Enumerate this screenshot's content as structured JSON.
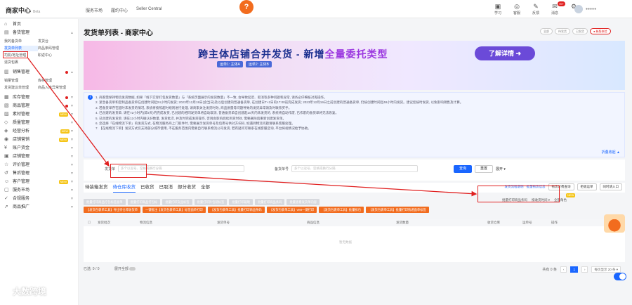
{
  "topbar": {
    "logo": "商家中心",
    "logo_beta": "Beta",
    "nav": [
      "服务市场",
      "履约中心",
      "Seller Central"
    ],
    "center_badge": "?",
    "icons": [
      {
        "name": "study-icon",
        "glyph": "▣",
        "label": "学习"
      },
      {
        "name": "support-icon",
        "glyph": "◎",
        "label": "客服"
      },
      {
        "name": "feedback-icon",
        "glyph": "✎",
        "label": "反馈"
      },
      {
        "name": "message-icon",
        "glyph": "✉",
        "label": "消息",
        "badge": "99+"
      },
      {
        "name": "settings-icon",
        "glyph": "⚙",
        "label": ""
      }
    ],
    "user_text": "●●●●●"
  },
  "sidebar": {
    "items": [
      {
        "label": "首页",
        "icon": "⌂"
      },
      {
        "label": "备货管理",
        "icon": "▤",
        "expanded": true,
        "sub": [
          "我的备货单",
          "发货台",
          "发货单列表",
          "商品条码管理",
          "司机/地址管理",
          "职返中心",
          "退货包裹"
        ]
      },
      {
        "label": "销售管理",
        "icon": "▥",
        "expanded": true,
        "dot": true,
        "sub": [
          "销量管理",
          "库存管理",
          "发货建议单管理",
          "商品入库异常管理"
        ]
      },
      {
        "label": "库存管理",
        "icon": "▦",
        "dot": true
      },
      {
        "label": "商品管理",
        "icon": "▧",
        "dot": true
      },
      {
        "label": "素材管理",
        "icon": "▨",
        "new": "NEW"
      },
      {
        "label": "质量管理",
        "icon": "◇"
      },
      {
        "label": "经营分析",
        "icon": "◈",
        "hot": "NEW"
      },
      {
        "label": "店铺营销",
        "icon": "◉",
        "new": "NEW"
      },
      {
        "label": "账户资金",
        "icon": "¥"
      },
      {
        "label": "店铺管理",
        "icon": "▣"
      },
      {
        "label": "评价管理",
        "icon": "☆"
      },
      {
        "label": "售后管理",
        "icon": "↺"
      },
      {
        "label": "客户管理",
        "icon": "☺",
        "new": "NEW"
      },
      {
        "label": "服务市场",
        "icon": "▢"
      },
      {
        "label": "合规服务",
        "icon": "✓"
      },
      {
        "label": "商品推广",
        "icon": "➚"
      }
    ]
  },
  "page": {
    "title": "发货单列表 - 商家中心",
    "toggles": [
      "全部",
      "待发货",
      "已发货",
      "● 新版体验"
    ]
  },
  "banner": {
    "title_a": "跨主体店铺合并发货 - 新增",
    "title_b": "全量委托类型",
    "tags": [
      "运单1: 主体A",
      "运单2: 主体B"
    ],
    "button": "了解详情 ➜"
  },
  "notice": {
    "lines": [
      "1. 商家需保持物流发货数据, 如果「线下实际打包发货数量」与「系统页面展示的发货数量」不一致, 会导致延迟、取消等多种问题和异常, 请务必仔细核对再操作。",
      "2. 紧急备货单和定制品备货单在创建时间起24小时内发货; 2023年12月19日(含当日)及以后创建的普通备货单, 在创建日T+2日的17:00前完成发货; 2023年12月19日之前创建的普通备货单, 仍按创建时间起48小时内发货。建议您按时发货, 以免影响销售及计算。",
      "3. 若备货单存在超时未发货的情况, 系统将按照超时规则进行处理, 请商家关注发货时效, 商品质量等问题导致的发货异常请及时联系买手。",
      "4. 已创建的发货单, 请在72小时内(即3天)内完成发货, 已创建的相同发货单将自动取消, 普通备货单自创建起10天内未发货的, 系统将自动作废, 已作废的备货单将无法恢复。",
      "5. 已创建的发货单, 请在12小时内确认好数量, 发货批次, 并及时完成发货操作, 否则会影响后续到货时效, 需要删除后重新创建发货单。",
      "6. 您选择「在线物流下单」的发货方式, 在物流服务商上门取件时, 需要展示发货单号及包裹号供对方扫码, 如遇到物流问题请联系客服处理。",
      "7. 【在线物流下单】发货方式仅支持部分城市使用, 不在服务范围内需要自行联系物流公司发货, 若有疑问可联系在线客服咨询, 平台将视情况给予协助。"
    ],
    "more": "折叠收起 ▲"
  },
  "search": {
    "label1": "发货单",
    "placeholder1": "多个以逗号、空格或换行分隔",
    "label2": "备货单号",
    "placeholder2": "多个以逗号、空格或换行分隔",
    "query": "查询",
    "reset": "重置",
    "expand": "展开 ▾"
  },
  "tabs": {
    "items": [
      "待装箱发货",
      "待仓库收货",
      "已收货",
      "已取消",
      "部分收货",
      "全部"
    ],
    "active": 1,
    "right_links": [
      "发货流程说明",
      "批量物流信息"
    ],
    "right_buttons": [
      "物流计费查询",
      "拒收运单",
      "同时请入口"
    ]
  },
  "actions": {
    "row1": [
      "批量打印商品打包标签面单",
      "批量打印商品打包标",
      "批量打印货品标签",
      "批量打印外包装标签",
      "批量打印箱唛",
      "批量打印商品条码",
      "批量查看发货单内容"
    ],
    "row2": [
      "【发货包裹单工具】导出待仓库收货单",
      "一键批注【发货包裹单工具】标签面单打印",
      "【发货包裹单工具】批量打印商品条码",
      "【发货包裹单工具】VMI一键打印",
      "【发货包裹单工具】批量拆包",
      "【发货包裹单工具】批量打印快递面单标签"
    ],
    "row2_hot": "NEW",
    "right_filter": [
      "批量打印商品条码",
      "按收货时间 ▾",
      "全部角色"
    ]
  },
  "table": {
    "headers": [
      "发货批次",
      "物流信息",
      "发货单号",
      "商品信息",
      "发货数量",
      "收货仓库",
      "运单号",
      "操作"
    ],
    "empty": "暂无数据"
  },
  "footer": {
    "selected": "已选: 0 / 0",
    "switch_label": "展开全部",
    "total": "共有 0 条",
    "page": "1",
    "per_page": "每页显示 20 条 ▾"
  },
  "watermark": "大数跨境",
  "colors": {
    "accent": "#1a66ff",
    "orange": "#f26c1e",
    "highlight": "#e02020"
  }
}
